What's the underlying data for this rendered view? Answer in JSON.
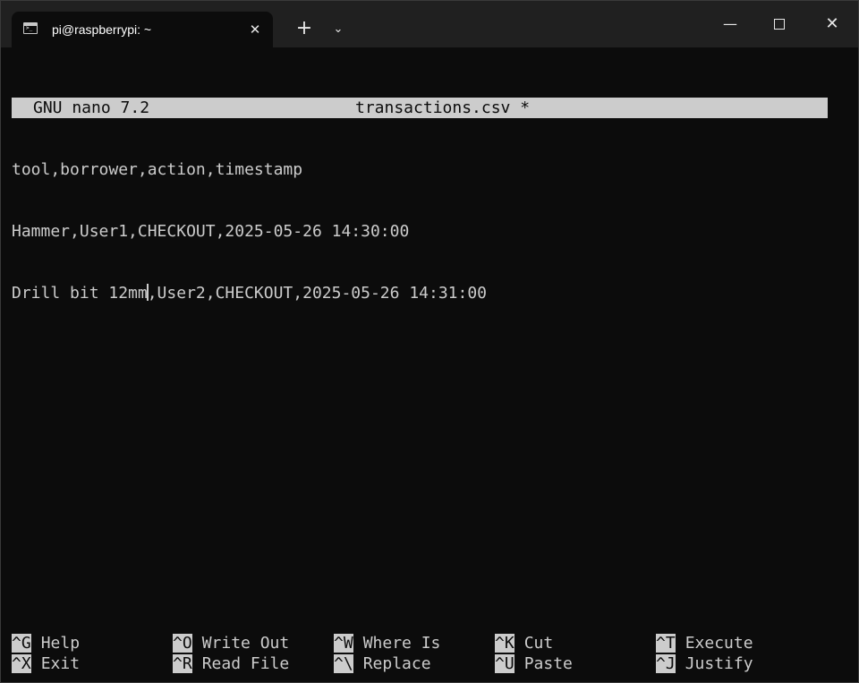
{
  "window": {
    "tab_title": "pi@raspberrypi: ~",
    "tab_close": "✕",
    "new_tab": "+",
    "dropdown": "⌄",
    "minimize": "—",
    "close": "✕"
  },
  "nano": {
    "version": "GNU nano 7.2",
    "filename": "transactions.csv *",
    "lines": [
      "tool,borrower,action,timestamp",
      "Hammer,User1,CHECKOUT,2025-05-26 14:30:00"
    ],
    "cursor_line": {
      "before": "Drill bit 12mm",
      "after": ",User2,CHECKOUT,2025-05-26 14:31:00"
    },
    "shortcuts": [
      {
        "key": "^G",
        "label": "Help"
      },
      {
        "key": "^O",
        "label": "Write Out"
      },
      {
        "key": "^W",
        "label": "Where Is"
      },
      {
        "key": "^K",
        "label": "Cut"
      },
      {
        "key": "^T",
        "label": "Execute"
      },
      {
        "key": "^X",
        "label": "Exit"
      },
      {
        "key": "^R",
        "label": "Read File"
      },
      {
        "key": "^\\",
        "label": "Replace"
      },
      {
        "key": "^U",
        "label": "Paste"
      },
      {
        "key": "^J",
        "label": "Justify"
      }
    ]
  }
}
